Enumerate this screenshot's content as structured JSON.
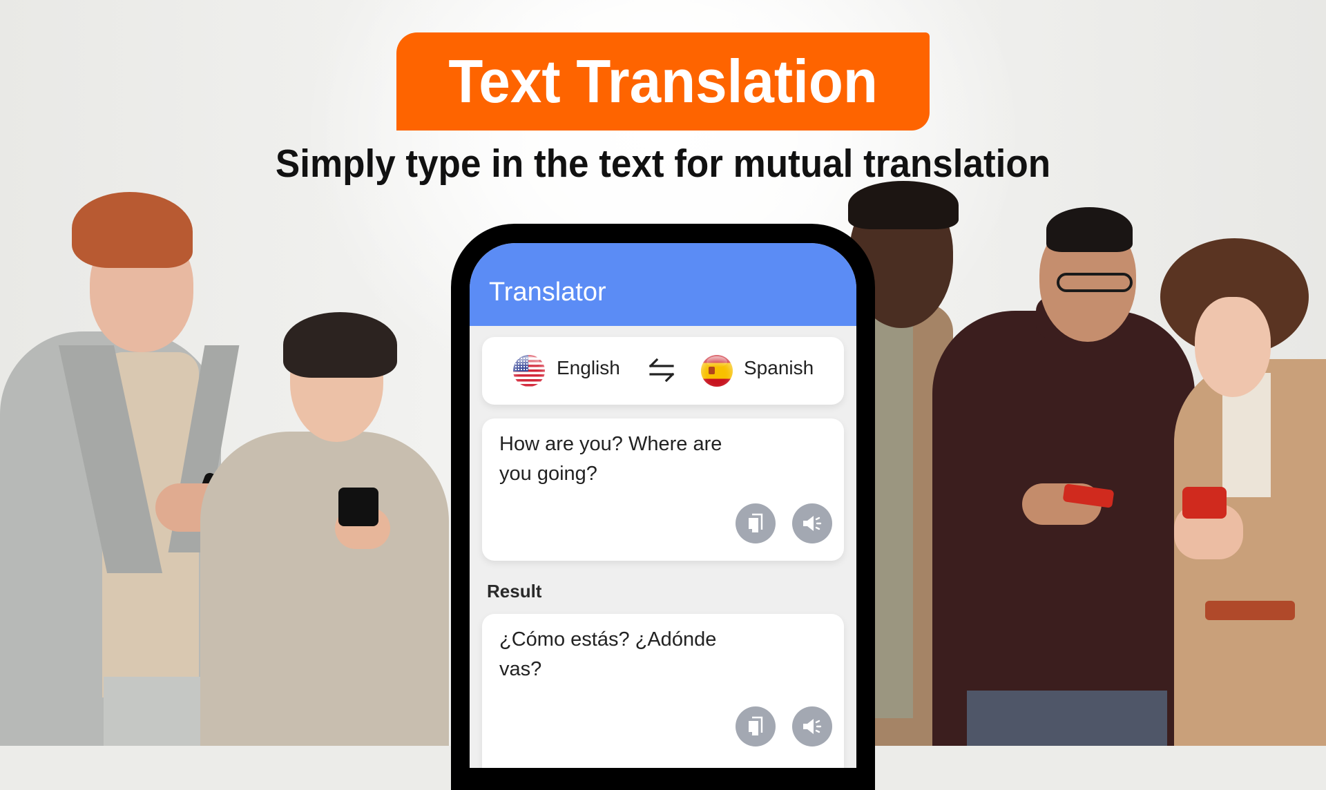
{
  "header": {
    "title": "Text Translation",
    "subtitle": "Simply type in the text for mutual translation"
  },
  "colors": {
    "banner": "#fe6400",
    "app_bar": "#5b8cf5",
    "icon_button": "#a3a8b2"
  },
  "app": {
    "title": "Translator",
    "language_selector": {
      "source": {
        "label": "English",
        "flag_icon": "us-flag-icon"
      },
      "swap_icon": "swap-arrows-icon",
      "target": {
        "label": "Spanish",
        "flag_icon": "spain-flag-icon"
      }
    },
    "input": {
      "text": "How are you? Where are you going?",
      "actions": [
        {
          "icon": "copy-icon"
        },
        {
          "icon": "speaker-icon"
        }
      ]
    },
    "result": {
      "label": "Result",
      "text": "¿Cómo estás? ¿Adónde vas?",
      "actions": [
        {
          "icon": "copy-icon"
        },
        {
          "icon": "speaker-icon"
        }
      ]
    }
  }
}
